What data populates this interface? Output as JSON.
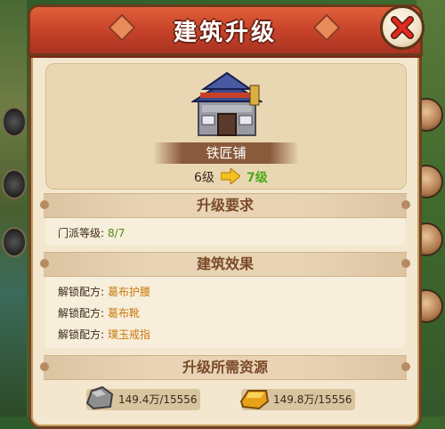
{
  "window": {
    "title": "建筑升级",
    "close_icon": "close-x-icon"
  },
  "building": {
    "name": "铁匠铺",
    "level_from": "6级",
    "level_to": "7级",
    "icon": "blacksmith-building-icon"
  },
  "requirements": {
    "header": "升级要求",
    "items": [
      {
        "label": "门派等级:",
        "value": "8/7"
      }
    ]
  },
  "effects": {
    "header": "建筑效果",
    "items": [
      {
        "label": "解锁配方:",
        "value": "葛布护腰"
      },
      {
        "label": "解锁配方:",
        "value": "葛布靴"
      },
      {
        "label": "解锁配方:",
        "value": "璞玉戒指"
      }
    ]
  },
  "resources": {
    "header": "升级所需资源",
    "items": [
      {
        "icon": "stone-icon",
        "value": "149.4万/15556"
      },
      {
        "icon": "gold-ingot-icon",
        "value": "149.8万/15556"
      }
    ]
  },
  "colors": {
    "title_bar": "#c8432a",
    "panel_bg": "#f3e7cf",
    "level_to": "#4caa1a",
    "requirement_value": "#4a8a10",
    "effect_value": "#c87a10"
  }
}
